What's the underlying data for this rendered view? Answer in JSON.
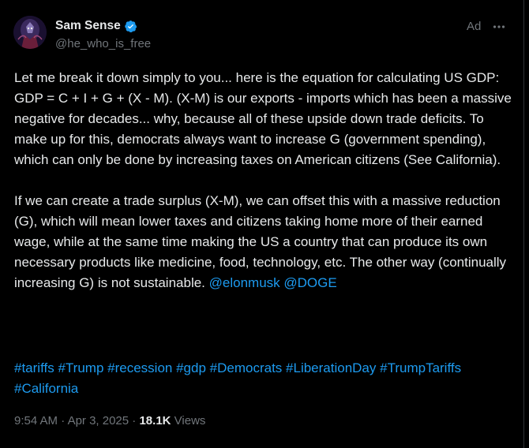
{
  "author": {
    "display_name": "Sam Sense",
    "handle": "@he_who_is_free",
    "verified": true
  },
  "ad_label": "Ad",
  "post": {
    "paragraph1": "Let me break it down simply to you... here is the equation for calculating US GDP: GDP = C + I + G + (X - M). (X-M) is our exports - imports which has been a massive negative for decades... why, because all of these upside down trade deficits. To make up for this, democrats always want to increase G (government spending), which can only be done by increasing taxes on American citizens (See California).",
    "paragraph2": "If we can create a trade surplus (X-M), we can offset this with a massive reduction (G), which will mean lower taxes and citizens taking home more of their earned wage, while at the same time making the US a country that can produce its own necessary products like medicine, food, technology, etc. The other way (continually increasing G) is not sustainable.",
    "mentions": [
      "@elonmusk",
      "@DOGE"
    ],
    "hashtags": [
      "#tariffs",
      "#Trump",
      "#recession",
      "#gdp",
      "#Democrats",
      "#LiberationDay",
      "#TrumpTariffs",
      "#California"
    ]
  },
  "meta": {
    "time": "9:54 AM",
    "separator": "·",
    "date": "Apr 3, 2025",
    "views_count": "18.1K",
    "views_label": "Views"
  },
  "colors": {
    "background": "#000000",
    "text": "#e7e9ea",
    "secondary": "#71767b",
    "link": "#1d9bf0",
    "verified": "#1d9bf0"
  },
  "icons": {
    "verified": "verified-badge-icon",
    "more": "more-horizontal-icon"
  }
}
